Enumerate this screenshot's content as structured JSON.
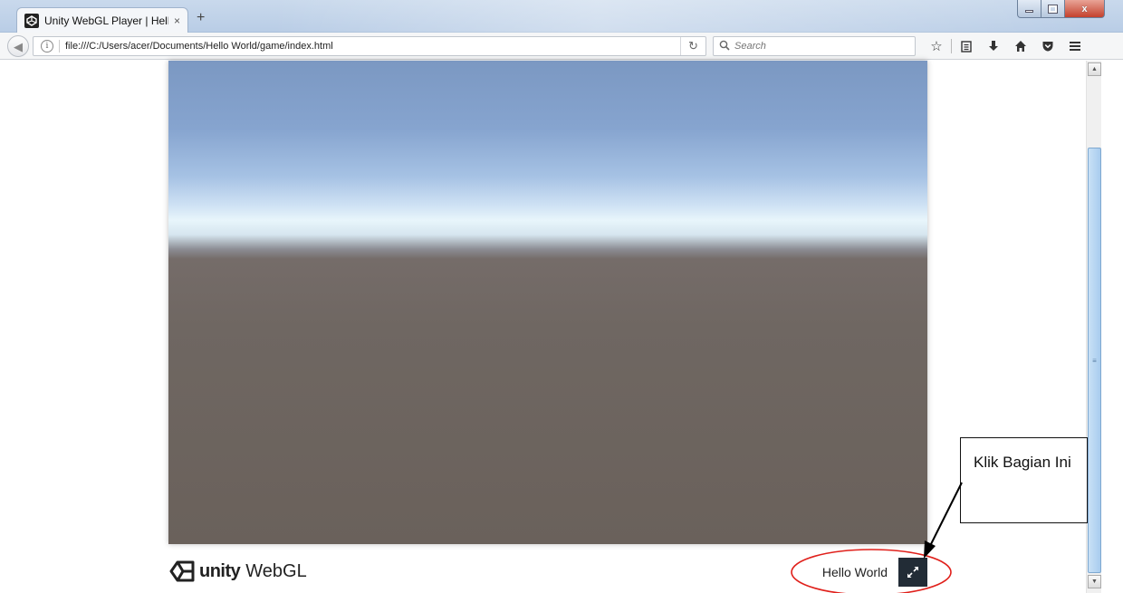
{
  "browser": {
    "tab": {
      "title": "Unity WebGL Player | Hello...",
      "close_glyph": "×"
    },
    "new_tab_glyph": "+",
    "window_controls": {
      "close_glyph": "x"
    },
    "url": "file:///C:/Users/acer/Documents/Hello World/game/index.html",
    "search_placeholder": "Search",
    "toolbar_icons": [
      "bookmark-star-icon",
      "reading-list-icon",
      "download-icon",
      "home-icon",
      "pocket-icon",
      "menu-icon"
    ]
  },
  "unity": {
    "logo_word": "unity",
    "logo_suffix": "WebGL",
    "game_title": "Hello World",
    "colors": {
      "sky_top": "#7b98c2",
      "horizon": "#e8f5fb",
      "ground": "#6a615b",
      "fullscreen_bg": "#222c36"
    }
  },
  "annotation": {
    "text": "Klik Bagian Ini",
    "circle_color": "#e0201b",
    "arrow_color": "#000000"
  }
}
